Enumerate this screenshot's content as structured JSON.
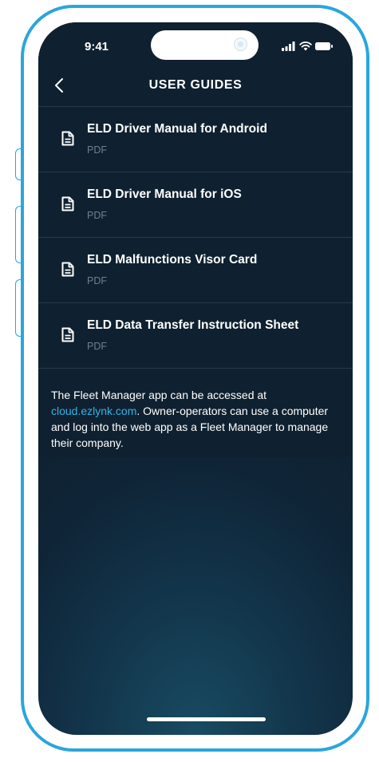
{
  "status_bar": {
    "time": "9:41",
    "icons": [
      "signal-icon",
      "wifi-icon",
      "battery-icon"
    ]
  },
  "header": {
    "title": "USER GUIDES",
    "back_icon": "chevron-left-icon"
  },
  "guides": [
    {
      "title": "ELD Driver Manual for Android",
      "type": "PDF",
      "icon": "document-icon"
    },
    {
      "title": "ELD Driver Manual for iOS",
      "type": "PDF",
      "icon": "document-icon"
    },
    {
      "title": "ELD Malfunctions Visor Card",
      "type": "PDF",
      "icon": "document-icon"
    },
    {
      "title": "ELD Data Transfer Instruction Sheet",
      "type": "PDF",
      "icon": "document-icon"
    }
  ],
  "info": {
    "before_link": "The Fleet Manager app can be accessed at ",
    "link": "cloud.ezlynk.com",
    "after_link": ". Owner-operators can use a computer and log into the web app as a Fleet Manager to manage their company."
  },
  "colors": {
    "frame": "#2aa6dc",
    "background": "#0f2130",
    "link": "#34b3e6",
    "muted_text": "#6f7f8c"
  }
}
